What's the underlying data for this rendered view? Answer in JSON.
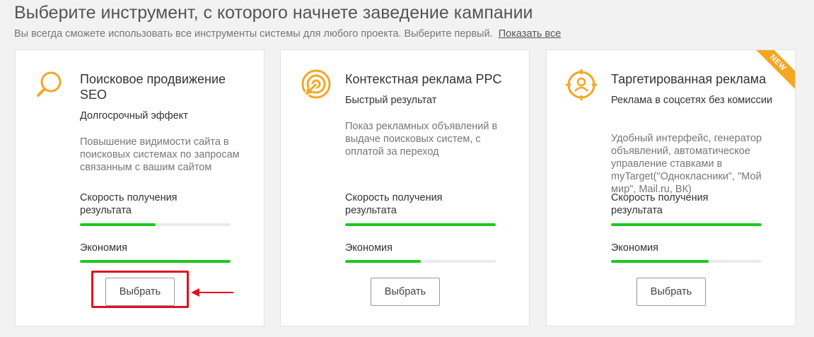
{
  "header": {
    "title": "Выберите инструмент, с которого начнете заведение кампании",
    "subtitle": "Вы всегда сможете использовать все инструменты системы для любого проекта. Выберите первый.",
    "show_all_link": "Показать все"
  },
  "accent_color": "#f5a623",
  "bar_color": "#1ec81e",
  "cards": [
    {
      "icon": "magnifier-icon",
      "title": "Поисковое продвижение SEO",
      "subtitle": "Долгосрочный эффект",
      "description": "Повышение видимости сайта в поисковых системах по запросам связанным с вашим сайтом",
      "speed_label": "Скорость получения результата",
      "speed_value": 0.5,
      "economy_label": "Экономия",
      "economy_value": 1.0,
      "button_label": "Выбрать"
    },
    {
      "icon": "target-cursor-icon",
      "title": "Контекстная реклама PPC",
      "subtitle": "Быстрый результат",
      "description": "Показ рекламных объявлений в выдаче поисковых систем, с оплатой за переход",
      "speed_label": "Скорость получения результата",
      "speed_value": 1.0,
      "economy_label": "Экономия",
      "economy_value": 0.5,
      "button_label": "Выбрать"
    },
    {
      "icon": "target-user-icon",
      "title": "Таргетированная реклама",
      "subtitle": "Реклама в соцсетях без комиссии",
      "description": "Удобный интерфейс, генератор объявлений, автоматическое управление ставками в myTarget(\"Однокласники\", \"Мой мир\", Mail.ru, ВК)",
      "speed_label": "Скорость получения результата",
      "speed_value": 1.0,
      "economy_label": "Экономия",
      "economy_value": 0.65,
      "button_label": "Выбрать",
      "badge": "NEW"
    }
  ]
}
